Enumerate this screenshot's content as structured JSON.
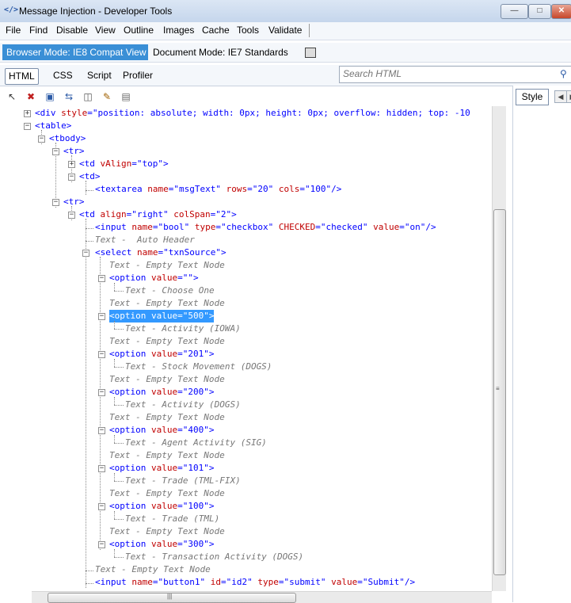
{
  "window": {
    "title": "Message Injection - Developer Tools"
  },
  "menu": [
    "File",
    "Find",
    "Disable",
    "View",
    "Outline",
    "Images",
    "Cache",
    "Tools",
    "Validate"
  ],
  "mode": {
    "browser": "Browser Mode: IE8 Compat View",
    "document": "Document Mode: IE7 Standards"
  },
  "tabs": [
    "HTML",
    "CSS",
    "Script",
    "Profiler"
  ],
  "search": {
    "placeholder": "Search HTML"
  },
  "right_panel": {
    "tab": "Style"
  },
  "tree": {
    "div_tag": "<div",
    "div_attr": "style",
    "div_eq": "=",
    "div_val": "\"position: absolute; width: 0px; height: 0px; overflow: hidden; top: -10",
    "table": "<table>",
    "tbody": "<tbody>",
    "tr1": "<tr>",
    "td1_tag": "<td",
    "td1_attr": "vAlign",
    "td1_val": "\"top\"",
    "td1_end": ">",
    "td2": "<td>",
    "ta_tag": "<textarea",
    "ta_a1": "name",
    "ta_v1": "\"msgText\"",
    "ta_a2": "rows",
    "ta_v2": "\"20\"",
    "ta_a3": "cols",
    "ta_v3": "\"100\"",
    "ta_end": "/>",
    "tr2": "<tr>",
    "td3_tag": "<td",
    "td3_a1": "align",
    "td3_v1": "\"right\"",
    "td3_a2": "colSpan",
    "td3_v2": "\"2\"",
    "td3_end": ">",
    "in_tag": "<input",
    "in_a1": "name",
    "in_v1": "\"bool\"",
    "in_a2": "type",
    "in_v2": "\"checkbox\"",
    "in_a3": "CHECKED",
    "in_v3": "\"checked\"",
    "in_a4": "value",
    "in_v4": "\"on\"",
    "in_end": "/>",
    "auto_header": "Text -  Auto Header",
    "sel_tag": "<select",
    "sel_a": "name",
    "sel_v": "\"txnSource\"",
    "sel_end": ">",
    "empty": "Text - Empty Text Node",
    "options": [
      {
        "value": "\"\"",
        "text": "Text - Choose One"
      },
      {
        "value": "\"500\"",
        "text": "Text - Activity (IOWA)"
      },
      {
        "value": "\"201\"",
        "text": "Text - Stock Movement (DOGS)"
      },
      {
        "value": "\"200\"",
        "text": "Text - Activity (DOGS)"
      },
      {
        "value": "\"400\"",
        "text": "Text - Agent Activity (SIG)"
      },
      {
        "value": "\"101\"",
        "text": "Text - Trade (TML-FIX)"
      },
      {
        "value": "\"100\"",
        "text": "Text - Trade (TML)"
      },
      {
        "value": "\"300\"",
        "text": "Text - Transaction Activity (DOGS)"
      }
    ],
    "opt_tag": "<option",
    "opt_attr": "value",
    "opt_end": ">",
    "selected_option": "<option value=\"500\">",
    "empty_after_select": "Text - Empty Text Node",
    "btn_tag": "<input",
    "btn_a1": "name",
    "btn_v1": "\"button1\"",
    "btn_a2": "id",
    "btn_v2": "\"id2\"",
    "btn_a3": "type",
    "btn_v3": "\"submit\"",
    "btn_a4": "value",
    "btn_v4": "\"Submit\"",
    "btn_end": "/>"
  }
}
